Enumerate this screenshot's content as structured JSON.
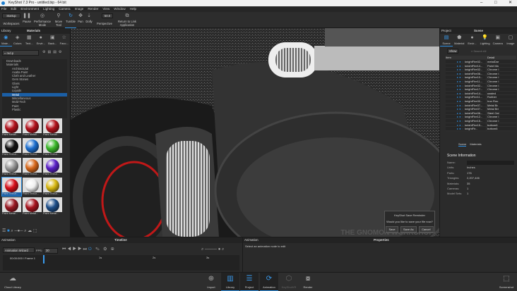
{
  "window": {
    "title": "KeyShot 7.3 Pro - untitled.bip - 64 bit",
    "min": "–",
    "max": "□",
    "close": "✕"
  },
  "menu": [
    "File",
    "Edit",
    "Environment",
    "Lighting",
    "Camera",
    "Image",
    "Render",
    "View",
    "Window",
    "Help"
  ],
  "toolbar": {
    "workspace_value": "Startup",
    "workspaces": "Workspaces",
    "pause": "Pause",
    "performance": "Performance Mode",
    "move": "Move Tool",
    "tumble": "Tumble",
    "pan": "Pan",
    "dolly": "Dolly",
    "fov_value": "50.0",
    "perspective": "Perspective",
    "return": "Return to Link Application"
  },
  "library": {
    "header_left": "Library",
    "header_title": "Materials",
    "tabs": [
      "Mate...",
      "Colors",
      "Text...",
      "Envir...",
      "Back...",
      "Favo..."
    ],
    "search_value": "red.p",
    "tree": [
      {
        "label": "Downloads",
        "root": true
      },
      {
        "label": "Materials",
        "root": true
      },
      {
        "label": "Architectural"
      },
      {
        "label": "Axalta Paint"
      },
      {
        "label": "Cloth and Leather"
      },
      {
        "label": "Gem Stones"
      },
      {
        "label": "Glass"
      },
      {
        "label": "Light"
      },
      {
        "label": "Liquids"
      },
      {
        "label": "Metal",
        "selected": true
      },
      {
        "label": "Miscellaneous"
      },
      {
        "label": "Mold-Tech"
      },
      {
        "label": "Paint"
      },
      {
        "label": "Plastic"
      }
    ],
    "thumbnails": [
      {
        "label": "Paint Metall...",
        "color": "#b3121c"
      },
      {
        "label": "Paint Metall...",
        "color": "#b3121c"
      },
      {
        "label": "Paint Metall...",
        "color": "#b3121c"
      },
      {
        "label": "Paint Textur...",
        "color": "#111111"
      },
      {
        "label": "Paint Textur...",
        "color": "#1c6fd0"
      },
      {
        "label": "Paint Textur...",
        "color": "#3bb82a"
      },
      {
        "label": "Paint Textur...",
        "color": "#9a9a9a"
      },
      {
        "label": "Paint Textur...",
        "color": "#d8681a"
      },
      {
        "label": "Paint Textur...",
        "color": "#5a20c8"
      },
      {
        "label": "Paint Textur...",
        "color": "#d8101a",
        "selected": true
      },
      {
        "label": "Paint Textur...",
        "color": "#f0f0f0"
      },
      {
        "label": "Paint Textur...",
        "color": "#d8b812"
      },
      {
        "label": "Paint Metal...",
        "color": "#9a1822"
      },
      {
        "label": "Paint Metal...",
        "color": "#a8141e"
      },
      {
        "label": "Paint Metal...",
        "color": "#1e4f8a"
      }
    ]
  },
  "scene": {
    "header_left": "Project",
    "header_title": "Scene",
    "tabs": [
      "Scene",
      "Material",
      "Envir...",
      "Lighting",
      "Camera",
      "Image"
    ],
    "show": "Show",
    "search_placeholder": "Search All",
    "col_item": "Item",
    "col_detail": "Detail",
    "rows": [
      [
        "knightFire02...",
        "metalDar"
      ],
      [
        "knightFire14...",
        "Paint Ma"
      ],
      [
        "knightFire02...",
        "Chrome I"
      ],
      [
        "knightFire06...",
        "Chrome I"
      ],
      [
        "knightFire10...",
        "Chrome I"
      ],
      [
        "knightFire11...",
        "Chrome I"
      ],
      [
        "knightFire02...",
        "Chrome I"
      ],
      [
        "knightFire17...",
        "Chrome I"
      ],
      [
        "knightFire14...",
        "pasted_"
      ],
      [
        "knightFire11...",
        "Rubber"
      ],
      [
        "knightFire00...",
        "Iron Rou"
      ],
      [
        "knightFire07...",
        "Metal Br"
      ],
      [
        "knightFire07...",
        "Metal Bri"
      ],
      [
        "knightFire06...",
        "Steel Gal"
      ],
      [
        "knightFire12...",
        "Chrome I"
      ],
      [
        "knightFire15...",
        "Chrome I"
      ],
      [
        "knightFire15...",
        "bottom6"
      ],
      [
        "knightFir...",
        "bottom6"
      ]
    ],
    "subtabs": [
      "Scene",
      "Materials"
    ],
    "info_title": "Scene Information",
    "info": [
      [
        "Name:",
        ""
      ],
      [
        "Units:",
        "Inches"
      ],
      [
        "Parts:",
        "176"
      ],
      [
        "Triangles:",
        "2,207,446"
      ],
      [
        "Materials:",
        "35"
      ],
      [
        "Cameras:",
        "1"
      ],
      [
        "Model Sets:",
        "1"
      ]
    ]
  },
  "animation": {
    "header_left": "Animation",
    "header_title": "Timeline",
    "wizard": "Animation Wizard",
    "fps_label": "FPS:",
    "fps_value": "30",
    "time": "00:00:000 / Frame 1",
    "ticks": [
      "1s",
      "2s",
      "3s"
    ]
  },
  "properties": {
    "header_left": "Animation",
    "header_title": "Properties",
    "message": "Select an animation node to edit"
  },
  "dialog": {
    "title": "KeyShot Save Reminder",
    "message": "Would you like to save your file now?",
    "save": "Save",
    "save_as": "Save As",
    "cancel": "Cancel"
  },
  "ribbon": {
    "cloud": "Cloud Library",
    "import": "Import",
    "library": "Library",
    "project": "Project",
    "animation": "Animation",
    "keyshotvr": "KeyShotVR",
    "render": "Render",
    "screenshot": "Screenshot"
  },
  "watermark": "THE GNOMON WORKSHOP"
}
